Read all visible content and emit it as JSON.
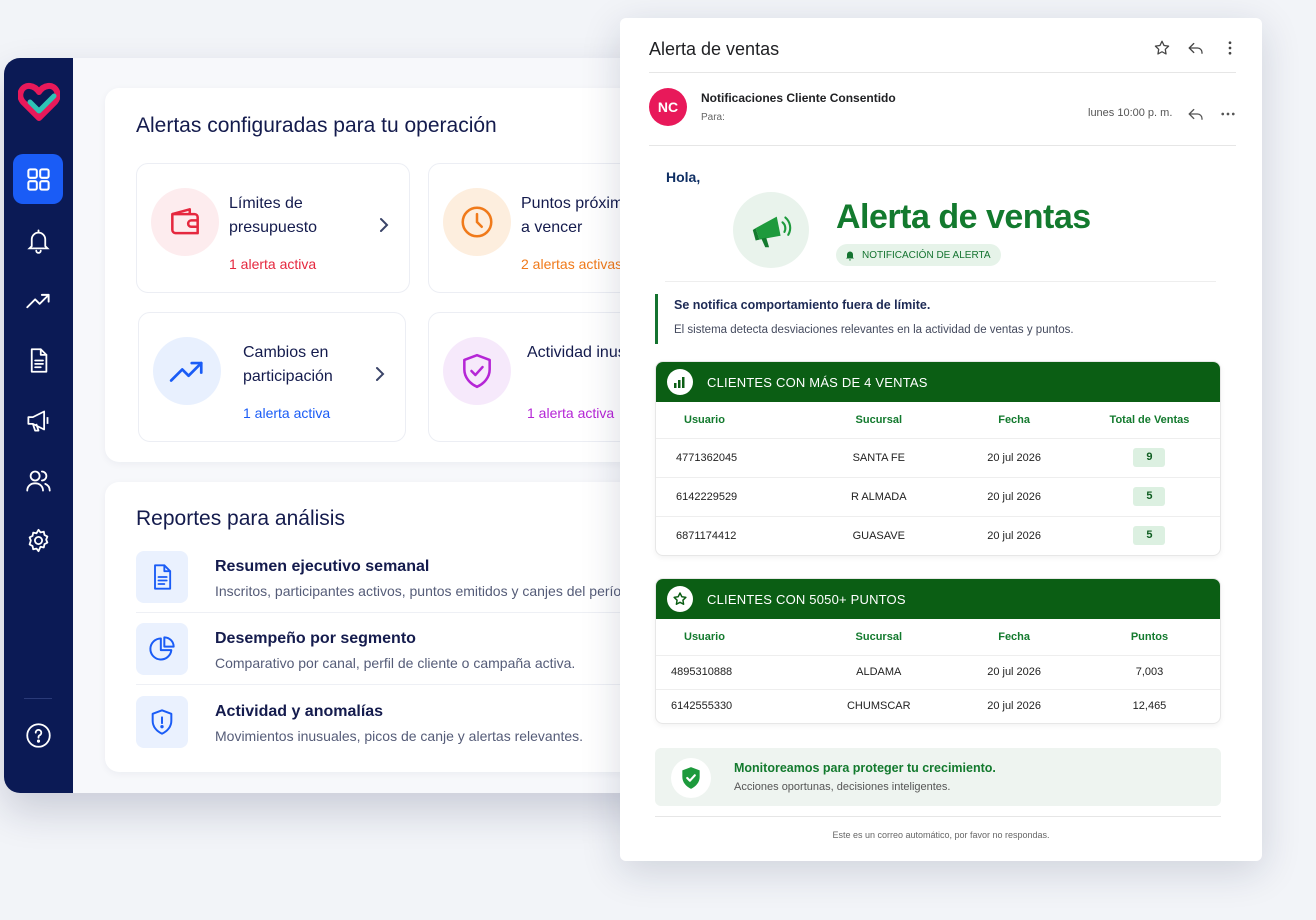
{
  "colors": {
    "sidebar_bg": "#0b1a55",
    "sidebar_active": "#1a5cf6",
    "brand_pink": "#e8195a",
    "brand_green": "#137a2e",
    "table_header_green": "#0b5e14"
  },
  "sidebar": {
    "items": [
      {
        "icon": "dashboard-grid-icon",
        "active": true
      },
      {
        "icon": "bell-icon",
        "active": false
      },
      {
        "icon": "trend-up-icon",
        "active": false
      },
      {
        "icon": "document-icon",
        "active": false
      },
      {
        "icon": "megaphone-icon",
        "active": false
      },
      {
        "icon": "users-icon",
        "active": false
      },
      {
        "icon": "gear-icon",
        "active": false
      }
    ],
    "help_icon": "help-icon"
  },
  "alerts_panel": {
    "title": "Alertas configuradas para tu operación",
    "cards": [
      {
        "title": "Límites de presupuesto",
        "status": "1 alerta activa",
        "icon": "wallet-icon",
        "accent": "#e5283f"
      },
      {
        "title": "Puntos próximos a vencer",
        "status": "2 alertas activas",
        "icon": "clock-icon",
        "accent": "#f07a1a"
      },
      {
        "title": "Cambios en participación",
        "status": "1 alerta activa",
        "icon": "trend-up-icon",
        "accent": "#1a5cf6"
      },
      {
        "title": "Actividad inusual",
        "status": "1 alerta activa",
        "icon": "shield-check-icon",
        "accent": "#b526d6"
      }
    ]
  },
  "reports_panel": {
    "title": "Reportes para análisis",
    "items": [
      {
        "title": "Resumen ejecutivo semanal",
        "desc": "Inscritos, participantes activos, puntos emitidos y canjes del período.",
        "icon": "document-icon"
      },
      {
        "title": "Desempeño por segmento",
        "desc": "Comparativo por canal, perfil de cliente o campaña activa.",
        "icon": "pie-chart-icon"
      },
      {
        "title": "Actividad y anomalías",
        "desc": "Movimientos inusuales, picos de canje y alertas relevantes.",
        "icon": "shield-alert-icon"
      }
    ]
  },
  "email": {
    "subject": "Alerta de ventas",
    "avatar_initials": "NC",
    "sender": "Notificaciones Cliente Consentido",
    "to_label": "Para:",
    "date": "lunes 10:00 p. m.",
    "greeting": "Hola,",
    "headline": "Alerta de ventas",
    "badge": "NOTIFICACIÓN DE ALERTA",
    "notice_title": "Se notifica comportamiento fuera de límite.",
    "notice_body": "El sistema detecta desviaciones relevantes en la actividad de ventas y puntos.",
    "sales_table": {
      "title": "CLIENTES CON MÁS DE 4 VENTAS",
      "columns": [
        "Usuario",
        "Sucursal",
        "Fecha",
        "Total de Ventas"
      ],
      "rows": [
        [
          "4771362045",
          "SANTA FE",
          "20 jul 2026",
          "9"
        ],
        [
          "6142229529",
          "R ALMADA",
          "20 jul 2026",
          "5"
        ],
        [
          "6871174412",
          "GUASAVE",
          "20 jul 2026",
          "5"
        ]
      ]
    },
    "points_table": {
      "title": "CLIENTES CON 5050+ PUNTOS",
      "columns": [
        "Usuario",
        "Sucursal",
        "Fecha",
        "Puntos"
      ],
      "rows": [
        [
          "4895310888",
          "ALDAMA",
          "20 jul 2026",
          "7,003"
        ],
        [
          "6142555330",
          "CHUMSCAR",
          "20 jul 2026",
          "12,465"
        ]
      ]
    },
    "footer_title": "Monitoreamos para proteger tu crecimiento.",
    "footer_body": "Acciones oportunas, decisiones inteligentes.",
    "auto_note": "Este es un correo automático, por favor no respondas."
  }
}
